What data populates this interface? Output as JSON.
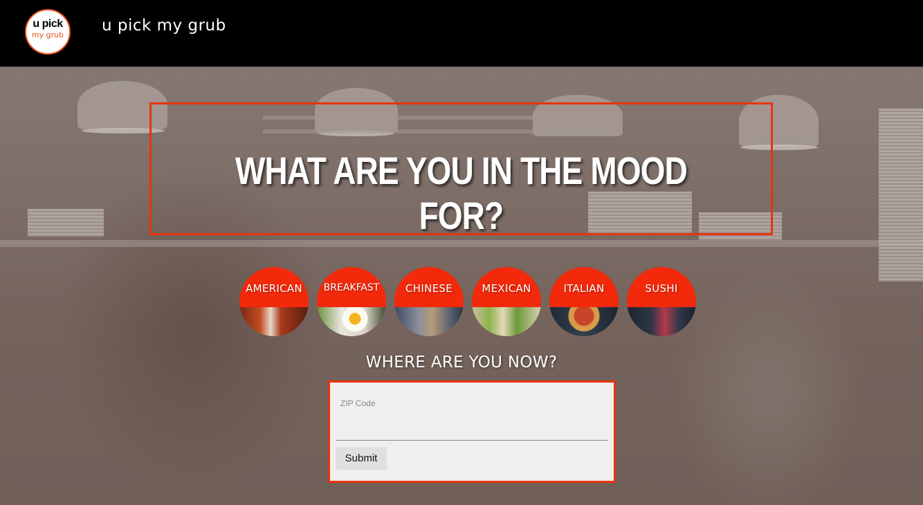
{
  "header": {
    "logo_line1": "u pick",
    "logo_line2": "my grub",
    "brand_title": "u pick my grub"
  },
  "hero": {
    "headline": "WHAT ARE YOU IN THE MOOD FOR?"
  },
  "cuisines": [
    {
      "label": "AMERICAN",
      "icon": "burger-photo"
    },
    {
      "label": "BREAKFAST",
      "icon": "egg-photo"
    },
    {
      "label": "CHINESE",
      "icon": "noodles-photo"
    },
    {
      "label": "MEXICAN",
      "icon": "tacos-photo"
    },
    {
      "label": "ITALIAN",
      "icon": "pizza-photo"
    },
    {
      "label": "SUSHI",
      "icon": "sushi-photo"
    }
  ],
  "location": {
    "heading": "WHERE ARE YOU NOW?",
    "zip_label": "ZIP Code",
    "zip_value": "",
    "submit_label": "Submit"
  },
  "colors": {
    "accent": "#e8330f",
    "cuisine_red": "#f2290a",
    "header_bg": "#000000"
  }
}
